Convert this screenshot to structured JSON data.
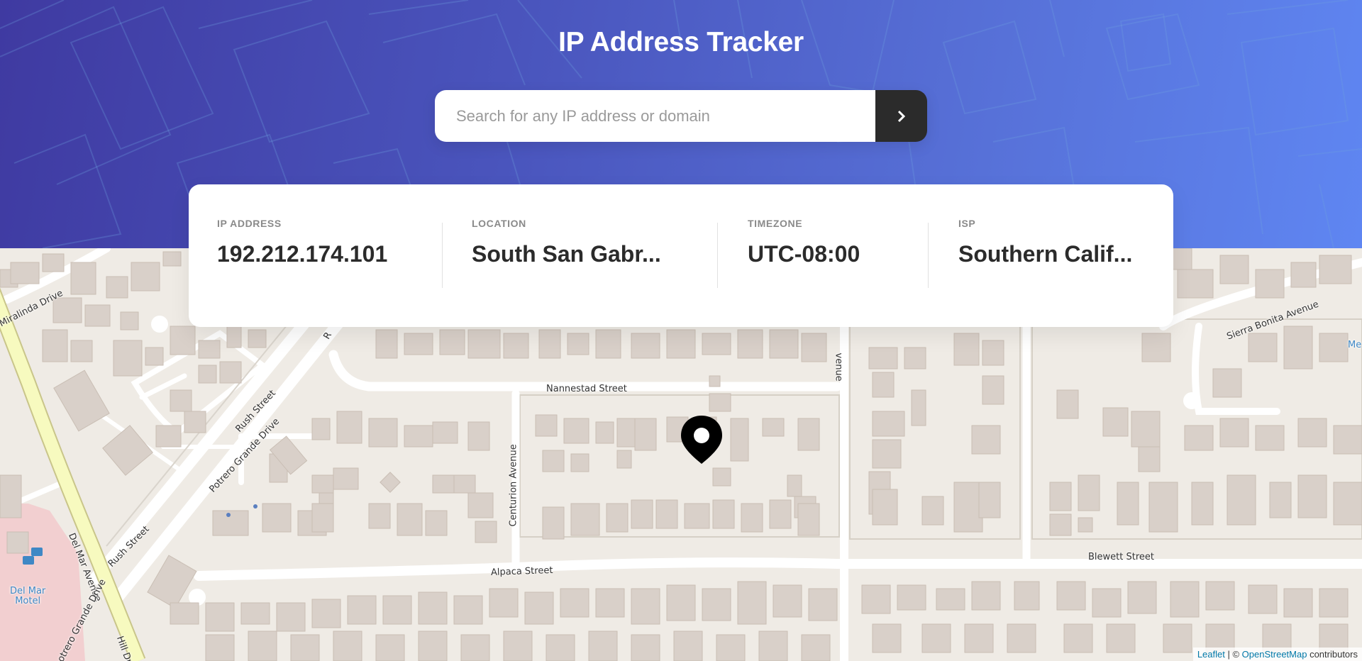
{
  "header": {
    "title": "IP Address Tracker",
    "search": {
      "placeholder": "Search for any IP address or domain",
      "value": ""
    },
    "submit_icon": "chevron-right-icon"
  },
  "info": [
    {
      "label": "IP ADDRESS",
      "value": "192.212.174.101"
    },
    {
      "label": "LOCATION",
      "value": "South San Gabr..."
    },
    {
      "label": "TIMEZONE",
      "value": "UTC-08:00"
    },
    {
      "label": "ISP",
      "value": "Southern Calif..."
    }
  ],
  "map": {
    "streets": {
      "miralinda": "Miralinda Drive",
      "rush_1": "Rush Street",
      "potrero_1": "Potrero Grande Drive",
      "del_mar": "Del Mar Avenue",
      "rush_2": "Rush Street",
      "potrero_2": "otrero Grande Drive",
      "hill": "Hill Driv",
      "nannestad": "Nannestad Street",
      "centurion": "Centurion Avenue",
      "alpaca": "Alpaca Street",
      "blewett": "Blewett Street",
      "sierra_bonita": "Sierra Bonita Avenue",
      "venue_partial": "venue",
      "r_partial": "R"
    },
    "poi": {
      "name_line1": "Del Mar",
      "name_line2": "Motel",
      "edge_text": "Me"
    },
    "marker_icon": "location-pin-icon",
    "attribution": {
      "leaflet": "Leaflet",
      "sep": " | © ",
      "osm": "OpenStreetMap",
      "suffix": " contributors"
    }
  },
  "colors": {
    "header_gradient_start": "#3f3aa1",
    "header_gradient_end": "#5f86f2",
    "button_dark": "#2b2b2b",
    "map_background": "#efebe5",
    "building": "#d9d0c9",
    "main_road": "#f7fabf"
  }
}
